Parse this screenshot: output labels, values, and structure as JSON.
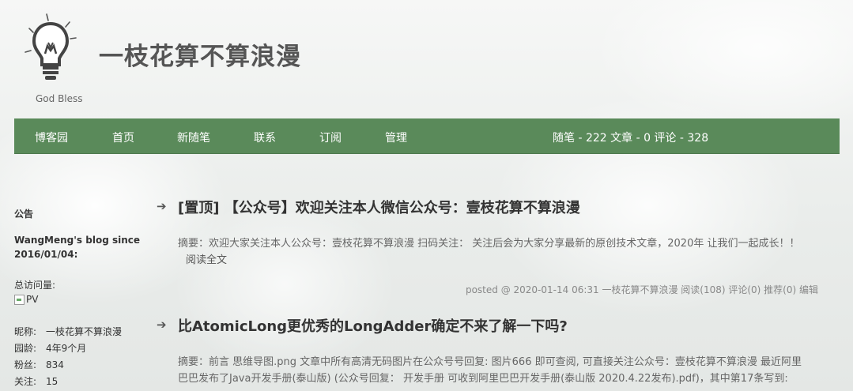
{
  "header": {
    "title": "一枝花算不算浪漫",
    "subtitle": "God Bless",
    "logo_icon": "lightbulb-icon"
  },
  "nav": {
    "items": [
      {
        "label": "博客园"
      },
      {
        "label": "首页"
      },
      {
        "label": "新随笔"
      },
      {
        "label": "联系"
      },
      {
        "label": "订阅"
      },
      {
        "label": "管理"
      }
    ],
    "stats": "随笔 - 222  文章 - 0  评论 - 328",
    "bg_color": "#5a8a5a"
  },
  "sidebar": {
    "notice_title": "公告",
    "since": "WangMeng's blog since 2016/01/04:",
    "visits_label": "总访问量:",
    "pv_alt": "PV",
    "rows": [
      {
        "key": "昵称:",
        "value": "一枝花算不算浪漫"
      },
      {
        "key": "园龄:",
        "value": "4年9个月"
      },
      {
        "key": "粉丝:",
        "value": "834"
      },
      {
        "key": "关注:",
        "value": "15"
      }
    ]
  },
  "posts": [
    {
      "title": "[置顶] 【公众号】欢迎关注本人微信公众号：壹枝花算不算浪漫",
      "summary": "摘要：欢迎大家关注本人公众号：壹枝花算不算浪漫 扫码关注： 关注后会为大家分享最新的原创技术文章，2020年 让我们一起成长！！",
      "read_more": "阅读全文",
      "meta": "posted @ 2020-01-14 06:31 一枝花算不算浪漫 阅读(108) 评论(0) 推荐(0) 编辑"
    },
    {
      "title": "比AtomicLong更优秀的LongAdder确定不来了解一下吗?",
      "summary": "摘要：前言 思维导图.png 文章中所有高清无码图片在公众号号回复: 图片666 即可查阅, 可直接关注公众号：壹枝花算不算浪漫 最近阿里巴巴发布了Java开发手册(泰山版) (公众号回复： 开发手册 可收到阿里巴巴开发手册(泰山版 2020.4.22发布).pdf)，其中第17条写到:",
      "read_more": "",
      "meta": ""
    }
  ]
}
